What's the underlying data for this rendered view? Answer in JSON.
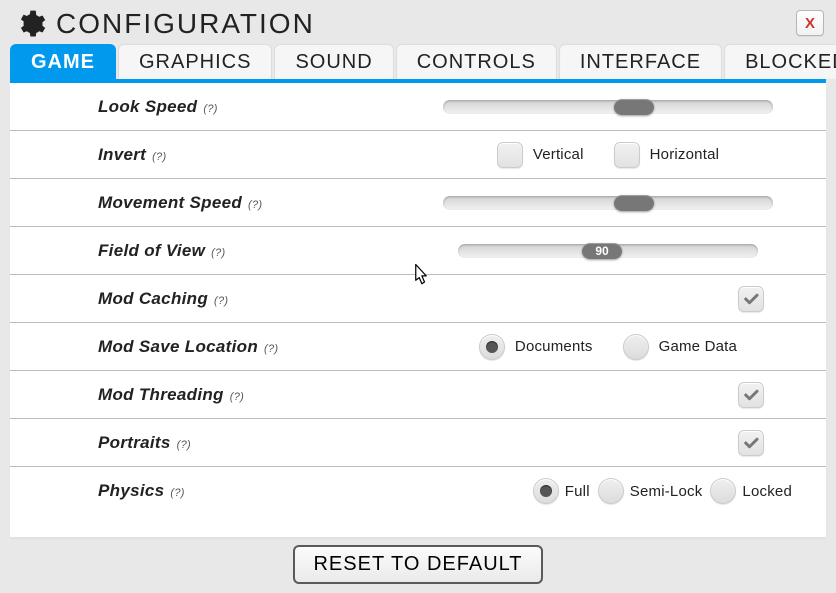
{
  "title": "CONFIGURATION",
  "close_label": "X",
  "tabs": [
    "GAME",
    "GRAPHICS",
    "SOUND",
    "CONTROLS",
    "INTERFACE",
    "BLOCKED"
  ],
  "active_tab": 0,
  "help_marker": "(?)",
  "rows": {
    "look_speed": {
      "label": "Look Speed",
      "slider_pct": 58
    },
    "invert": {
      "label": "Invert",
      "opt_a": "Vertical",
      "opt_b": "Horizontal",
      "a_checked": false,
      "b_checked": false
    },
    "move_speed": {
      "label": "Movement Speed",
      "slider_pct": 58
    },
    "fov": {
      "label": "Field of View",
      "slider_pct": 45,
      "value_text": "90"
    },
    "mod_caching": {
      "label": "Mod Caching",
      "checked": true
    },
    "mod_save": {
      "label": "Mod Save Location",
      "opt_a": "Documents",
      "opt_b": "Game Data",
      "a_selected": true,
      "b_selected": false
    },
    "mod_thread": {
      "label": "Mod Threading",
      "checked": true
    },
    "portraits": {
      "label": "Portraits",
      "checked": true
    },
    "physics": {
      "label": "Physics",
      "opt_a": "Full",
      "opt_b": "Semi-Lock",
      "opt_c": "Locked",
      "a_selected": true,
      "b_selected": false,
      "c_selected": false
    }
  },
  "reset_label": "RESET TO DEFAULT"
}
